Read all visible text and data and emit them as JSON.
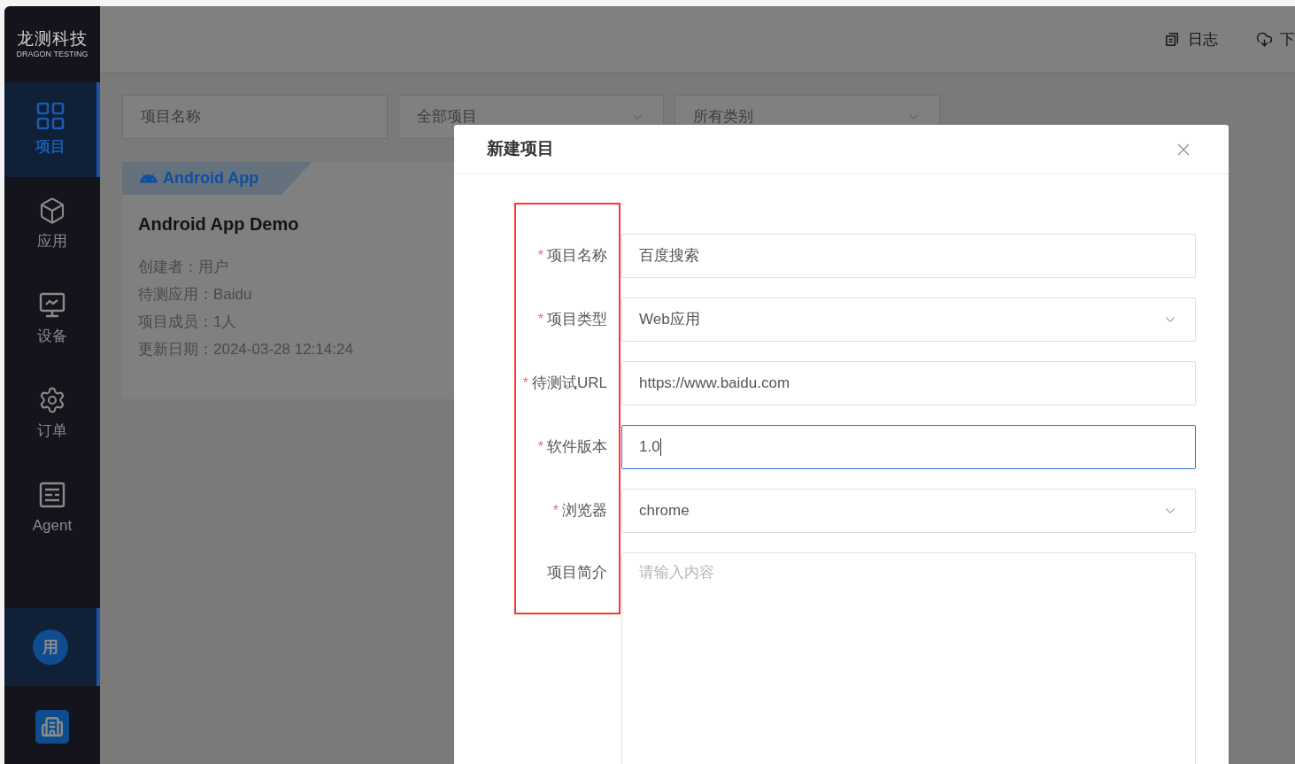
{
  "logo": {
    "title": "龙测科技",
    "subtitle": "DRAGON TESTING"
  },
  "sidebar": {
    "items": [
      {
        "label": "项目",
        "selected": true
      },
      {
        "label": "应用",
        "selected": false
      },
      {
        "label": "设备",
        "selected": false
      },
      {
        "label": "订单",
        "selected": false
      },
      {
        "label": "Agent",
        "selected": false
      }
    ],
    "avatar": {
      "text": "用",
      "selected": true
    }
  },
  "header": {
    "actions": [
      {
        "label": "日志"
      },
      {
        "label": "下"
      }
    ]
  },
  "filters": [
    {
      "kind": "input",
      "placeholder": "项目名称"
    },
    {
      "kind": "select",
      "placeholder": "全部项目"
    },
    {
      "kind": "select",
      "placeholder": "所有类别"
    }
  ],
  "cards": [
    {
      "tag": "Android App",
      "title": "Android App Demo",
      "lines": [
        "创建者：用户",
        "待测应用：Baidu",
        "项目成员：1人",
        "更新日期：2024-03-28 12:14:24"
      ]
    }
  ],
  "dialog": {
    "title": "新建项目",
    "fields": [
      {
        "label": "项目名称",
        "required_mark": "*",
        "kind": "input",
        "value": "百度搜索",
        "focused": false
      },
      {
        "label": "项目类型",
        "required_mark": "*",
        "kind": "select",
        "value": "Web应用",
        "focused": false
      },
      {
        "label": "待测试URL",
        "required_mark": "*",
        "kind": "input",
        "value": "https://www.baidu.com",
        "focused": false
      },
      {
        "label": "软件版本",
        "required_mark": "*",
        "kind": "input",
        "value": "1.0",
        "focused": true
      },
      {
        "label": "浏览器",
        "required_mark": "*",
        "kind": "select",
        "value": "chrome",
        "focused": false
      },
      {
        "label": "项目简介",
        "kind": "textarea",
        "placeholder": "请输入内容",
        "focused": false
      }
    ]
  }
}
